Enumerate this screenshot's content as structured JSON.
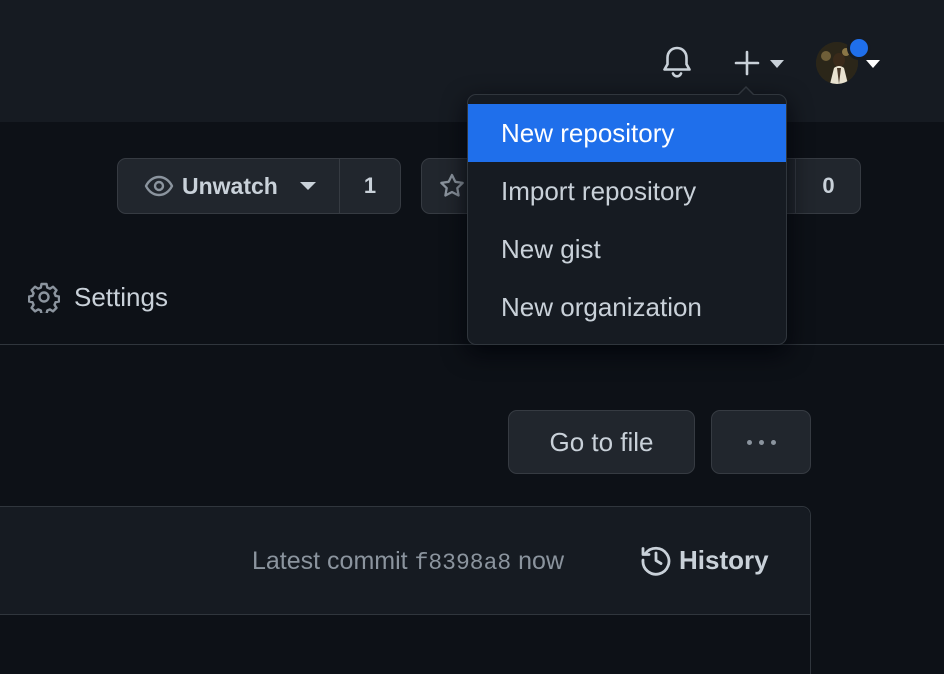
{
  "header": {
    "icons": {
      "notifications": "bell-icon",
      "create": "plus-icon",
      "avatar_badge_color": "#1f6feb"
    }
  },
  "create_menu": {
    "items": [
      {
        "label": "New repository",
        "active": true
      },
      {
        "label": "Import repository",
        "active": false
      },
      {
        "label": "New gist",
        "active": false
      },
      {
        "label": "New organization",
        "active": false
      }
    ]
  },
  "repo_actions": {
    "unwatch": {
      "label": "Unwatch",
      "count": "1"
    },
    "fork": {
      "count": "0"
    }
  },
  "nav": {
    "settings_label": "Settings"
  },
  "file_actions": {
    "go_to_file_label": "Go to file"
  },
  "commit": {
    "latest_label": "Latest commit",
    "sha": "f8398a8",
    "time": "now",
    "history_label": "History"
  },
  "colors": {
    "accent": "#1f6feb",
    "background": "#0d1117",
    "header": "#161b22",
    "button": "#21262d",
    "border": "#30363d",
    "text": "#c9d1d9",
    "muted": "#8b949e"
  }
}
